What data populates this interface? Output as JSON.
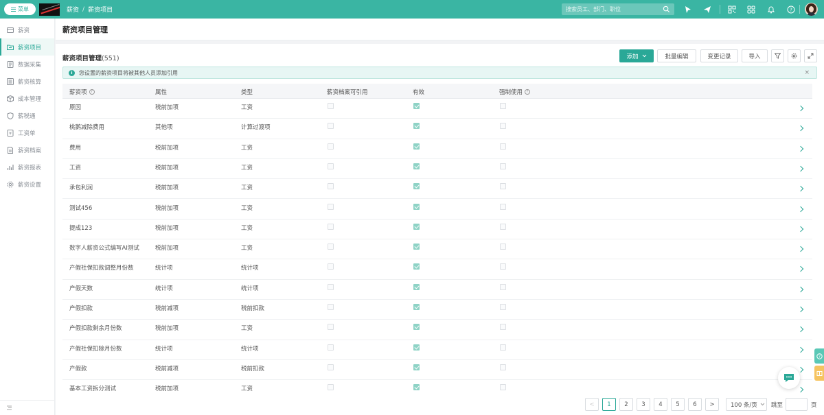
{
  "topbar": {
    "menu_label": "菜单",
    "breadcrumb": [
      "薪资",
      "薪资项目"
    ],
    "breadcrumb_sep": "/",
    "search_placeholder": "搜索员工、部门、职位"
  },
  "sidebar": {
    "items": [
      {
        "label": "薪资",
        "icon": "folder-icon"
      },
      {
        "label": "薪资项目",
        "icon": "folder-icon",
        "active": true
      },
      {
        "label": "数据采集",
        "icon": "document-icon"
      },
      {
        "label": "薪资核算",
        "icon": "list-icon"
      },
      {
        "label": "成本管理",
        "icon": "box-icon"
      },
      {
        "label": "薪税通",
        "icon": "shield-icon"
      },
      {
        "label": "工资单",
        "icon": "payslip-icon"
      },
      {
        "label": "薪资档案",
        "icon": "file-icon"
      },
      {
        "label": "薪资报表",
        "icon": "bar-chart-icon"
      },
      {
        "label": "薪资设置",
        "icon": "gear-icon"
      }
    ]
  },
  "page_title": "薪资项目管理",
  "card": {
    "title": "薪资项目管理",
    "count": "(551)",
    "buttons": {
      "add": "添加",
      "batch_edit": "批量编辑",
      "change_log": "变更记录",
      "import": "导入"
    },
    "notice": "您设置的薪资项目将被其他人员添加引用",
    "notice_info": "i",
    "notice_close": "×"
  },
  "table": {
    "columns": [
      "薪资项",
      "属性",
      "类型",
      "薪资档案可引用",
      "有效",
      "强制使用"
    ],
    "help_mark": "?",
    "rows": [
      {
        "name": "原因",
        "attr": "税前加项",
        "type": "工资",
        "ref": false,
        "valid": true,
        "forced": false
      },
      {
        "name": "桃鹅减除费用",
        "attr": "其他项",
        "type": "计算过渡项",
        "ref": false,
        "valid": true,
        "forced": false
      },
      {
        "name": "费用",
        "attr": "税前加项",
        "type": "工资",
        "ref": false,
        "valid": true,
        "forced": false
      },
      {
        "name": "工资",
        "attr": "税前加项",
        "type": "工资",
        "ref": false,
        "valid": true,
        "forced": false
      },
      {
        "name": "承包利润",
        "attr": "税前加项",
        "type": "工资",
        "ref": false,
        "valid": true,
        "forced": false
      },
      {
        "name": "测试456",
        "attr": "税前加项",
        "type": "工资",
        "ref": false,
        "valid": true,
        "forced": false
      },
      {
        "name": "提成123",
        "attr": "税前加项",
        "type": "工资",
        "ref": false,
        "valid": true,
        "forced": false
      },
      {
        "name": "数字人薪资公式编写AI测试",
        "attr": "税前加项",
        "type": "工资",
        "ref": false,
        "valid": true,
        "forced": false
      },
      {
        "name": "产假社保扣款调整月份数",
        "attr": "统计项",
        "type": "统计项",
        "ref": false,
        "valid": true,
        "forced": false
      },
      {
        "name": "产假天数",
        "attr": "统计项",
        "type": "统计项",
        "ref": false,
        "valid": true,
        "forced": false
      },
      {
        "name": "产假扣款",
        "attr": "税前减项",
        "type": "税前扣款",
        "ref": false,
        "valid": true,
        "forced": false
      },
      {
        "name": "产假扣款剩余月份数",
        "attr": "税前加项",
        "type": "工资",
        "ref": false,
        "valid": true,
        "forced": false
      },
      {
        "name": "产假社保扣除月份数",
        "attr": "统计项",
        "type": "统计项",
        "ref": false,
        "valid": true,
        "forced": false
      },
      {
        "name": "产假款",
        "attr": "税前减项",
        "type": "税前扣款",
        "ref": false,
        "valid": true,
        "forced": false
      },
      {
        "name": "基本工资拆分测试",
        "attr": "税前加项",
        "type": "工资",
        "ref": false,
        "valid": true,
        "forced": false
      }
    ]
  },
  "pagination": {
    "prev": "<",
    "next": ">",
    "pages": [
      "1",
      "2",
      "3",
      "4",
      "5",
      "6"
    ],
    "current": 1,
    "page_size": "100 条/页",
    "jump_label": "跳至",
    "page_unit": "页"
  },
  "colors": {
    "brand": "#3ab5a3",
    "accent": "#2aa897"
  }
}
